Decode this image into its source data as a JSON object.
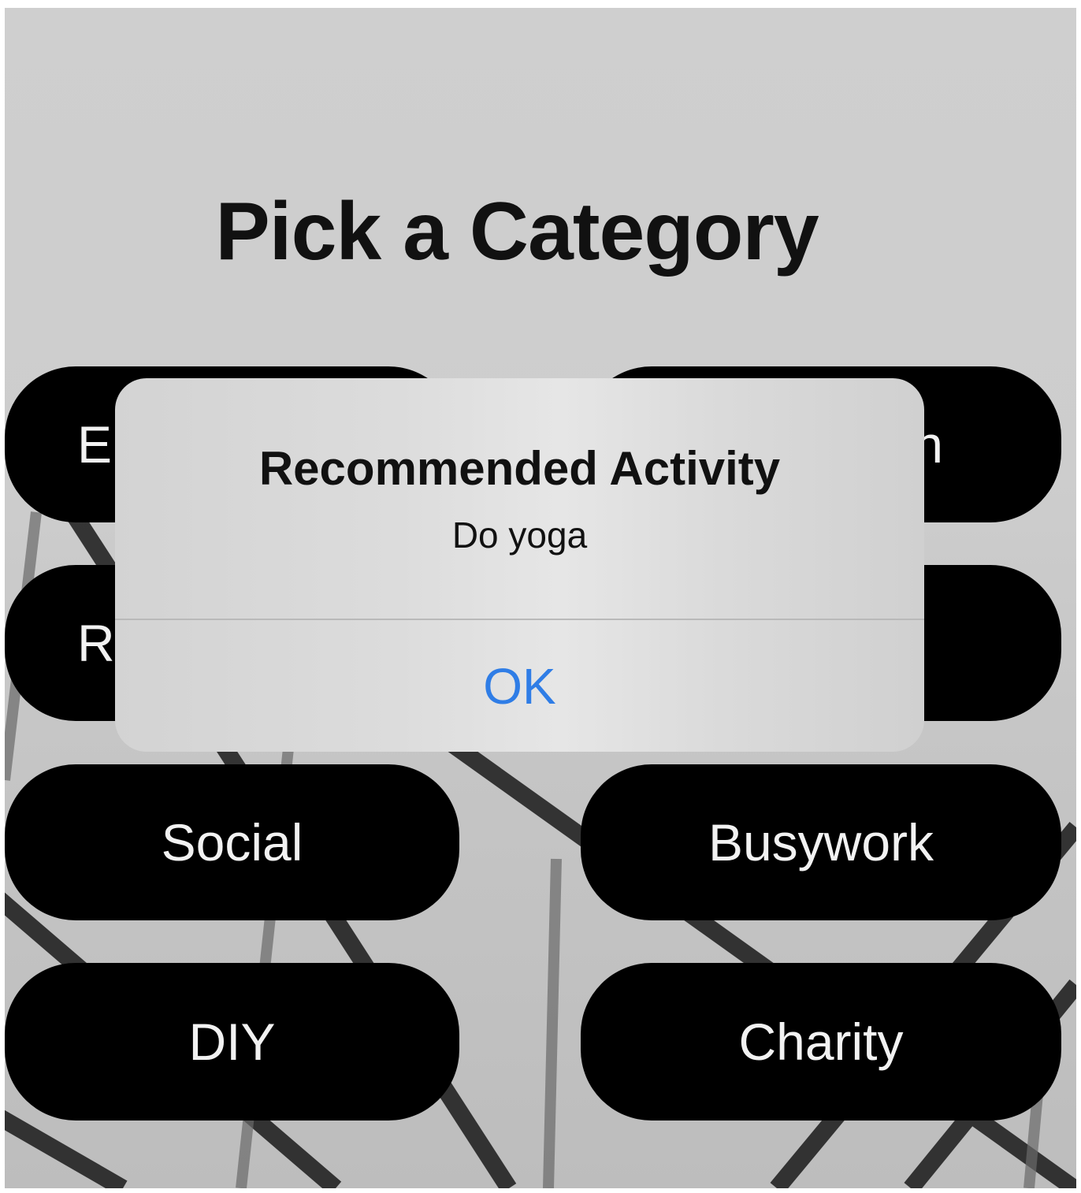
{
  "title": "Pick a Category",
  "categories": {
    "row1_left": "E",
    "row1_right": "n",
    "row2_left": "R",
    "social": "Social",
    "busywork": "Busywork",
    "diy": "DIY",
    "charity": "Charity"
  },
  "alert": {
    "title": "Recommended Activity",
    "message": "Do yoga",
    "ok_label": "OK"
  },
  "colors": {
    "button_bg": "#000000",
    "button_text": "#f2f2f2",
    "alert_ok": "#2f7de6"
  }
}
